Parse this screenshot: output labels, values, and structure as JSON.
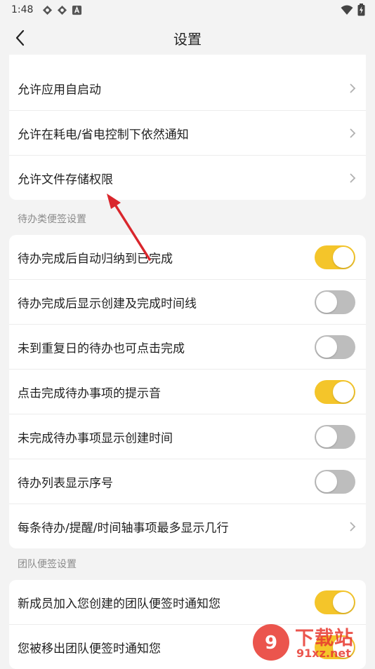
{
  "status_bar": {
    "time": "1:48",
    "icons": [
      "app-notification-icon",
      "app-notification-icon",
      "a-icon"
    ],
    "right_icons": [
      "wifi-icon",
      "battery-icon"
    ]
  },
  "header": {
    "title": "设置",
    "back_icon": "back-arrow-icon"
  },
  "permissions_card": {
    "items": [
      {
        "label": "允许应用自启动"
      },
      {
        "label": "允许在耗电/省电控制下依然通知"
      },
      {
        "label": "允许文件存储权限"
      }
    ]
  },
  "todo_section": {
    "title": "待办类便签设置",
    "items": [
      {
        "label": "待办完成后自动归纳到已完成",
        "toggle": true
      },
      {
        "label": "待办完成后显示创建及完成时间线",
        "toggle": false
      },
      {
        "label": "未到重复日的待办也可点击完成",
        "toggle": false
      },
      {
        "label": "点击完成待办事项的提示音",
        "toggle": true
      },
      {
        "label": "未完成待办事项显示创建时间",
        "toggle": false
      },
      {
        "label": "待办列表显示序号",
        "toggle": false
      },
      {
        "label": "每条待办/提醒/时间轴事项最多显示几行"
      }
    ]
  },
  "team_section": {
    "title": "团队便签设置",
    "items": [
      {
        "label": "新成员加入您创建的团队便签时通知您",
        "toggle": true
      },
      {
        "label": "您被移出团队便签时通知您",
        "toggle": true
      }
    ]
  },
  "watermark": {
    "text": "下载站",
    "domain": "91xz.net"
  },
  "colors": {
    "toggle_on": "#f4c52a",
    "toggle_off": "#bdbdbd",
    "annotation_arrow": "#d9262c"
  }
}
